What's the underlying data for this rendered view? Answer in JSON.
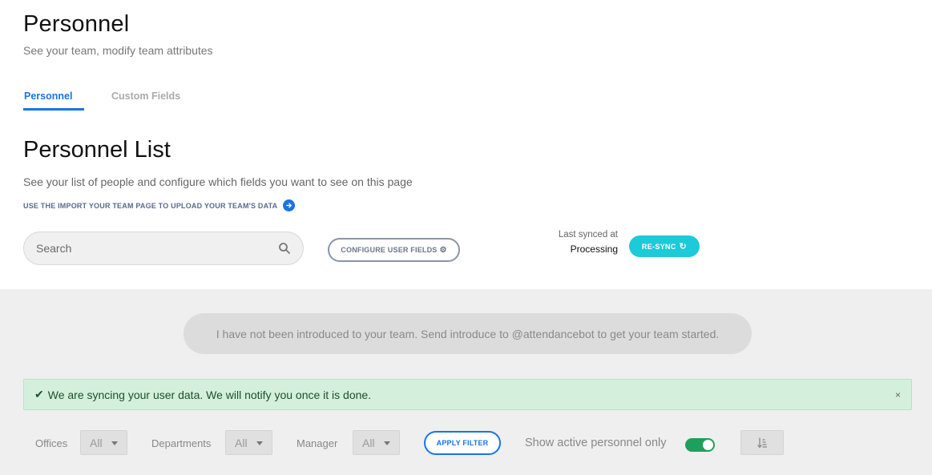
{
  "header": {
    "title": "Personnel",
    "subtitle": "See your team, modify team attributes",
    "tabs": [
      {
        "label": "Personnel",
        "active": true
      },
      {
        "label": "Custom Fields",
        "active": false
      }
    ]
  },
  "list": {
    "title": "Personnel List",
    "description": "See your list of people and configure which fields you want to see on this page",
    "import_link": "USE THE IMPORT YOUR TEAM PAGE TO UPLOAD YOUR TEAM'S DATA",
    "search_placeholder": "Search",
    "configure_label": "CONFIGURE USER FIELDS",
    "sync_label": "Last synced at",
    "sync_status": "Processing",
    "resync_label": "RE-SYNC"
  },
  "intro_message": "I have not been introduced to your team. Send introduce to @attendancebot to get your team started.",
  "alert": {
    "message": "We are syncing your user data. We will notify you once it is done.",
    "close": "×"
  },
  "filters": {
    "offices_label": "Offices",
    "offices_value": "All",
    "departments_label": "Departments",
    "departments_value": "All",
    "manager_label": "Manager",
    "manager_value": "All",
    "apply_label": "APPLY FILTER",
    "active_only_label": "Show active personnel only",
    "active_only_on": true
  },
  "colors": {
    "accent": "#1a73e8",
    "resync": "#1ccad8",
    "toggle_on": "#1ea05a",
    "alert_bg": "#d4f0dc"
  }
}
